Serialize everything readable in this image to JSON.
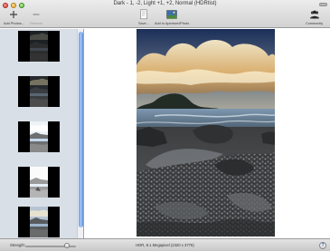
{
  "window": {
    "title": "Dark - 1, -2, Light +1, +2, Normal (HDRtist)"
  },
  "toolbar": {
    "add_photos_label": "Add Photos...",
    "remove_label": "Remove",
    "save_label": "Save...",
    "add_iphoto_label": "Add to Aperture/iPhoto",
    "community_label": "Community"
  },
  "icons": {
    "add": "plus-icon",
    "remove": "minus-icon",
    "save": "save-icon",
    "iphoto": "photo-icon",
    "community": "people-icon",
    "help": "question-icon"
  },
  "sidebar": {
    "thumbnails": [
      {
        "exposure": "dark-2"
      },
      {
        "exposure": "dark-1"
      },
      {
        "exposure": "light+1"
      },
      {
        "exposure": "light+2"
      },
      {
        "exposure": "normal"
      }
    ]
  },
  "footer": {
    "strength_label": "Strength:",
    "slider_value": 0.82,
    "status": "HDR, 8.1 Megapixel (2320 x 3776)",
    "help_glyph": "?"
  },
  "colors": {
    "scroll_accent": "#6b9be2",
    "sidebar_bg": "#d9dfe7"
  }
}
